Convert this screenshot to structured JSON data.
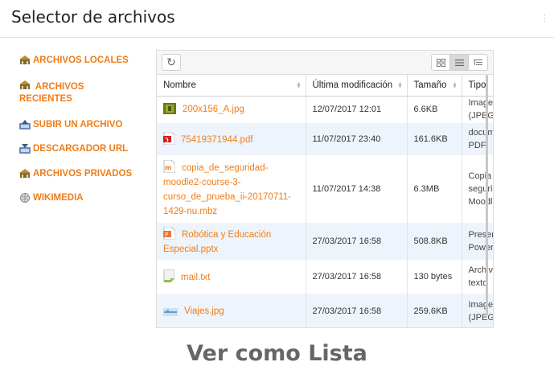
{
  "window": {
    "title": "Selector de archivos"
  },
  "sidebar": {
    "items": [
      {
        "label": "ARCHIVOS LOCALES",
        "icon": "server-icon"
      },
      {
        "label": "ARCHIVOS RECIENTES",
        "icon": "server-icon"
      },
      {
        "label": "SUBIR UN ARCHIVO",
        "icon": "upload-icon"
      },
      {
        "label": "DESCARGADOR URL",
        "icon": "download-icon"
      },
      {
        "label": "ARCHIVOS PRIVADOS",
        "icon": "server-icon"
      },
      {
        "label": "WIKIMEDIA",
        "icon": "globe-icon"
      }
    ]
  },
  "toolbar": {
    "refresh_icon": "refresh-icon",
    "views": [
      "icons-view-icon",
      "list-view-icon",
      "tree-view-icon"
    ],
    "active_view": "list-view-icon"
  },
  "table": {
    "headers": {
      "name": "Nombre",
      "date": "Última modificación",
      "size": "Tamaño",
      "type": "Tipo"
    },
    "rows": [
      {
        "name": "200x156_A.jpg",
        "date": "12/07/2017 12:01",
        "size": "6.6KB",
        "type1": "Image",
        "type2": "(JPEG",
        "icon": "image-icon"
      },
      {
        "name": "75419371944.pdf",
        "date": "11/07/2017 23:40",
        "size": "161.6KB",
        "type1": "docum",
        "type2": "PDF",
        "icon": "pdf-icon"
      },
      {
        "name": "copia_de_seguridad-moodle2-course-3-curso_de_prueba_ii-20170711-1429-nu.mbz",
        "date": "11/07/2017 14:38",
        "size": "6.3MB",
        "type1": "Copia",
        "type2": "seguri",
        "type3": "Moodl",
        "icon": "moodle-backup-icon"
      },
      {
        "name": "Robótica y Educación Especial.pptx",
        "date": "27/03/2017 16:58",
        "size": "508.8KB",
        "type1": "Preser",
        "type2": "Power",
        "icon": "presentation-icon"
      },
      {
        "name": "mail.txt",
        "date": "27/03/2017 16:58",
        "size": "130 bytes",
        "type1": "Archiv",
        "type2": "texto",
        "icon": "text-file-icon"
      },
      {
        "name": "Viajes.jpg",
        "date": "27/03/2017 16:58",
        "size": "259.6KB",
        "type1": "Image",
        "type2": "(JPEG",
        "icon": "image-icon"
      }
    ]
  },
  "caption": "Ver como Lista",
  "colors": {
    "accent": "#f07d17",
    "row_alt": "#eef4fb"
  }
}
